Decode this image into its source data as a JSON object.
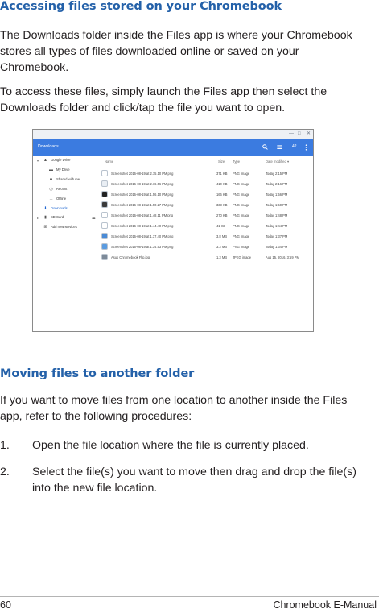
{
  "section1": {
    "heading": "Accessing files stored on your Chromebook",
    "para1_lines": [
      "The Downloads folder inside the Files app is where your Chromebook",
      "stores all types of files downloaded online or saved on your",
      "Chromebook."
    ],
    "para2_lines": [
      "To access these files, simply launch the Files app then select the",
      "Downloads folder and click/tap the file you want to open."
    ]
  },
  "screenshot": {
    "window_controls": [
      "—",
      "□",
      "✕"
    ],
    "title": "Downloads",
    "toolbar": {
      "search_icon": "search-icon",
      "grid_icon": "grid-view-icon",
      "count": "42",
      "menu_icon": "more-icon"
    },
    "sidebar": [
      {
        "label": "Google Drive",
        "icon": "drive-icon",
        "level": 0,
        "expander": "▾"
      },
      {
        "label": "My Drive",
        "icon": "folder-icon",
        "level": 1
      },
      {
        "label": "Shared with me",
        "icon": "people-icon",
        "level": 1
      },
      {
        "label": "Recent",
        "icon": "clock-icon",
        "level": 1
      },
      {
        "label": "Offline",
        "icon": "pin-icon",
        "level": 1
      },
      {
        "label": "Downloads",
        "icon": "download-icon",
        "level": 0,
        "active": true
      },
      {
        "label": "SD Card",
        "icon": "sd-card-icon",
        "level": 0,
        "expander": "▸",
        "eject": "⏏"
      },
      {
        "label": "Add new services",
        "icon": "plus-icon",
        "level": 0
      }
    ],
    "columns": {
      "name": "Name",
      "size": "Size",
      "type": "Type",
      "date": "Date modified ▾"
    },
    "files": [
      {
        "name": "Screenshot 2016-08-19 at 2.15.10 PM.png",
        "size": "371 KB",
        "type": "PNG image",
        "date": "Today 2:15 PM",
        "thumb": "#ffffff"
      },
      {
        "name": "Screenshot 2016-08-19 at 2.16.56 PM.png",
        "size": "410 KB",
        "type": "PNG image",
        "date": "Today 2:16 PM",
        "thumb": "#e9eef4"
      },
      {
        "name": "Screenshot 2016-08-19 at 1.56.10 PM.png",
        "size": "166 KB",
        "type": "PNG image",
        "date": "Today 1:56 PM",
        "thumb": "#222222"
      },
      {
        "name": "Screenshot 2016-08-19 at 1.50.27 PM.png",
        "size": "333 KB",
        "type": "PNG image",
        "date": "Today 1:50 PM",
        "thumb": "#3a3a3a"
      },
      {
        "name": "Screenshot 2016-08-19 at 1.48.11 PM.png",
        "size": "270 KB",
        "type": "PNG image",
        "date": "Today 1:48 PM",
        "thumb": "#ffffff"
      },
      {
        "name": "Screenshot 2016-08-19 at 1.44.40 PM.png",
        "size": "41 KB",
        "type": "PNG image",
        "date": "Today 1:44 PM",
        "thumb": "#ffffff"
      },
      {
        "name": "Screenshot 2016-08-19 at 1.37.40 PM.png",
        "size": "3.8 MB",
        "type": "PNG image",
        "date": "Today 1:37 PM",
        "thumb": "#4a8bd6"
      },
      {
        "name": "Screenshot 2016-08-19 at 1.34.53 PM.png",
        "size": "3.3 MB",
        "type": "PNG image",
        "date": "Today 1:34 PM",
        "thumb": "#5a9be0"
      },
      {
        "name": "Asus Chromebook Flip.jpg",
        "size": "1.3 MB",
        "type": "JPEG image",
        "date": "Aug 15, 2016, 3:59 PM",
        "thumb": "#7d8a99"
      }
    ]
  },
  "section2": {
    "heading": "Moving files to another folder",
    "intro_lines": [
      "If you want to move files from one location to another inside the Files",
      "app, refer to the following procedures:"
    ],
    "steps": [
      {
        "num": "1.",
        "lines": [
          "Open the file location where the file is currently placed."
        ]
      },
      {
        "num": "2.",
        "lines": [
          "Select the file(s) you want to move then drag and drop the file(s)",
          "into the new file location."
        ]
      }
    ]
  },
  "footer": {
    "page_number": "60",
    "manual_title": "Chromebook E-Manual"
  },
  "colors": {
    "heading": "#2461a9",
    "app_bar": "#3b7be0",
    "text": "#231f20"
  }
}
